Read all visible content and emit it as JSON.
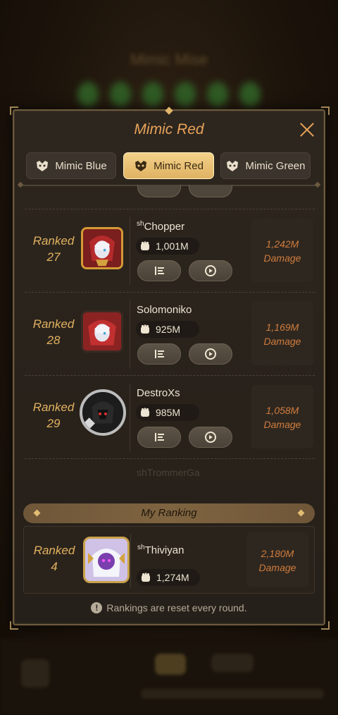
{
  "panel": {
    "title": "Mimic Red",
    "tabs": [
      {
        "label": "Mimic Blue",
        "active": false
      },
      {
        "label": "Mimic Red",
        "active": true
      },
      {
        "label": "Mimic Green",
        "active": false
      }
    ]
  },
  "rankings": [
    {
      "rank_label": "Ranked",
      "rank": "27",
      "name_prefix": "sh",
      "name": "Chopper",
      "power": "1,001M",
      "damage": "1,242M",
      "damage_label": "Damage"
    },
    {
      "rank_label": "Ranked",
      "rank": "28",
      "name_prefix": "",
      "name": "Solomoniko",
      "power": "925M",
      "damage": "1,169M",
      "damage_label": "Damage"
    },
    {
      "rank_label": "Ranked",
      "rank": "29",
      "name_prefix": "",
      "name": "DestroXs",
      "power": "985M",
      "damage": "1,058M",
      "damage_label": "Damage"
    }
  ],
  "partial_next_name": "shTrommerGa",
  "my_ranking": {
    "header": "My Ranking",
    "rank_label": "Ranked",
    "rank": "4",
    "name_prefix": "sh",
    "name": "Thiviyan",
    "power": "1,274M",
    "damage": "2,180M",
    "damage_label": "Damage"
  },
  "footer_note": "Rankings are reset every round.",
  "colors": {
    "accent": "#e9a35c",
    "rank_gold": "#e2b15f",
    "damage_orange": "#d07c3c",
    "tab_active": "#f0c97f"
  },
  "icons": {
    "close": "close-icon",
    "mimic": "mimic-head-icon",
    "power": "fist-icon",
    "details": "list-details-icon",
    "replay": "replay-icon",
    "info": "info-icon"
  },
  "background": {
    "blurred_title": "Mimic Mise"
  }
}
